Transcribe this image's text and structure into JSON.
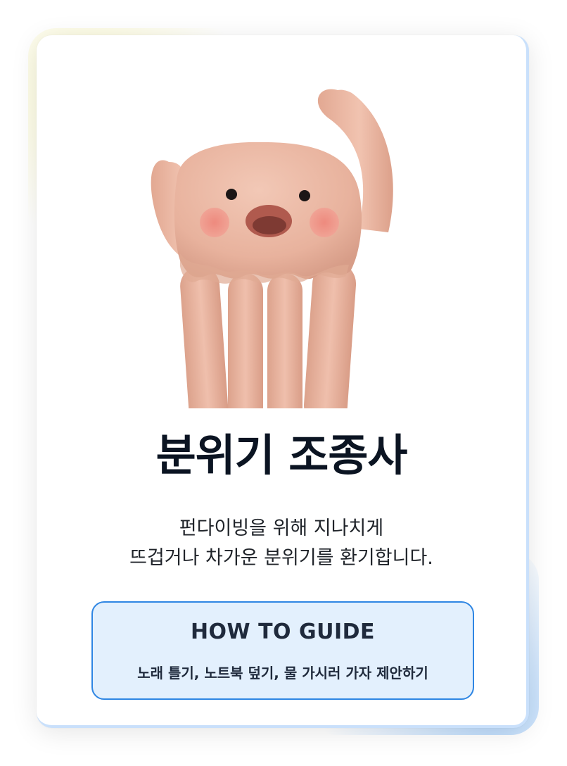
{
  "card": {
    "title": "분위기 조종사",
    "description_lines": [
      "펀다이빙을 위해 지나치게",
      "뜨겁거나 차가운 분위기를 환기합니다."
    ],
    "illustration": "jellyfish-character-illustration"
  },
  "guide": {
    "title": "HOW TO GUIDE",
    "subtitle": "노래 틀기, 노트북 덮기, 물 가시러 가자 제안하기"
  },
  "colors": {
    "accent": "#2f86e3",
    "guide_bg": "#e3f0fd",
    "title": "#0b1422",
    "character_body": "#ebb9a4",
    "cheek": "#ea8c80",
    "mouth": "#9c4a40"
  }
}
